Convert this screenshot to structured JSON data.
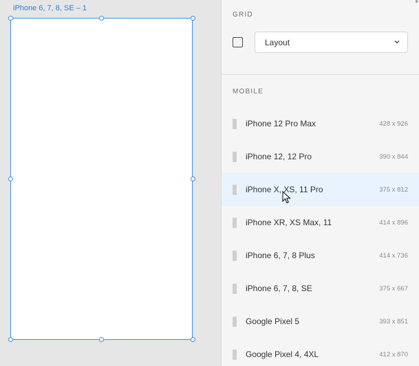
{
  "artboard": {
    "label": "iPhone 6, 7, 8, SE – 1"
  },
  "panel": {
    "grid_section": {
      "title": "GRID",
      "checkbox_checked": false,
      "select_value": "Layout"
    },
    "mobile_section": {
      "title": "MOBILE"
    },
    "devices": [
      {
        "name": "iPhone 12 Pro Max",
        "size": "428 x 926"
      },
      {
        "name": "iPhone 12, 12 Pro",
        "size": "390 x 844"
      },
      {
        "name": "iPhone X, XS, 11 Pro",
        "size": "375 x 812"
      },
      {
        "name": "iPhone XR, XS Max, 11",
        "size": "414 x 896"
      },
      {
        "name": "iPhone 6, 7, 8 Plus",
        "size": "414 x 736"
      },
      {
        "name": "iPhone 6, 7, 8, SE",
        "size": "375 x 667"
      },
      {
        "name": "Google Pixel 5",
        "size": "393 x 851"
      },
      {
        "name": "Google Pixel 4, 4XL",
        "size": "412 x 870"
      }
    ],
    "hovered_device_index": 2
  },
  "colors": {
    "selection_blue": "#3b8ee5",
    "hover_row": "#e8f3fd"
  }
}
